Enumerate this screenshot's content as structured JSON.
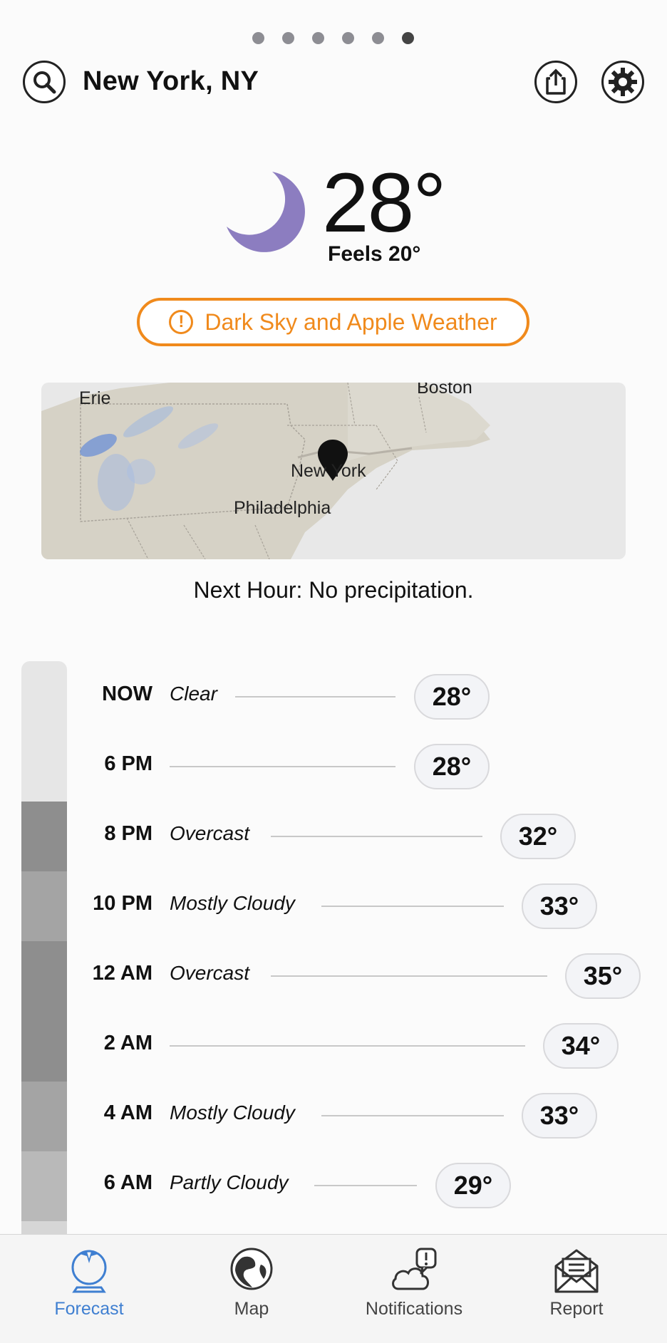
{
  "page_indicator": {
    "count": 6,
    "active_index": 5
  },
  "header": {
    "location": "New York, NY",
    "search_icon": "search-icon",
    "share_icon": "share-icon",
    "settings_icon": "gear-icon"
  },
  "current": {
    "icon": "moon-icon",
    "temperature": "28°",
    "feels_like": "Feels 20°"
  },
  "alert": {
    "label": "Dark Sky and Apple Weather",
    "icon": "alert-icon"
  },
  "map": {
    "labels": [
      "Erie",
      "Boston",
      "New York",
      "Philadelphia"
    ]
  },
  "next_hour": "Next Hour: No precipitation.",
  "hourly": [
    {
      "time": "NOW",
      "summary": "Clear",
      "temp": "28°",
      "temp_value": 28
    },
    {
      "time": "6 PM",
      "summary": "",
      "temp": "28°",
      "temp_value": 28
    },
    {
      "time": "8 PM",
      "summary": "Overcast",
      "temp": "32°",
      "temp_value": 32
    },
    {
      "time": "10 PM",
      "summary": "Mostly Cloudy",
      "temp": "33°",
      "temp_value": 33
    },
    {
      "time": "12 AM",
      "summary": "Overcast",
      "temp": "35°",
      "temp_value": 35
    },
    {
      "time": "2 AM",
      "summary": "",
      "temp": "34°",
      "temp_value": 34
    },
    {
      "time": "4 AM",
      "summary": "Mostly Cloudy",
      "temp": "33°",
      "temp_value": 33
    },
    {
      "time": "6 AM",
      "summary": "Partly Cloudy",
      "temp": "29°",
      "temp_value": 29
    }
  ],
  "condition_colors": {
    "clear": "#e6e6e6",
    "overcast": "#8e8e8e",
    "mostly_cloudy": "#a4a4a4",
    "partly_cloudy": "#b9b9b9"
  },
  "accent_color": "#f08a1c",
  "tabs": [
    {
      "label": "Forecast",
      "icon": "crystal-ball-icon",
      "active": true
    },
    {
      "label": "Map",
      "icon": "globe-icon",
      "active": false
    },
    {
      "label": "Notifications",
      "icon": "cloud-alert-icon",
      "active": false
    },
    {
      "label": "Report",
      "icon": "envelope-icon",
      "active": false
    }
  ]
}
